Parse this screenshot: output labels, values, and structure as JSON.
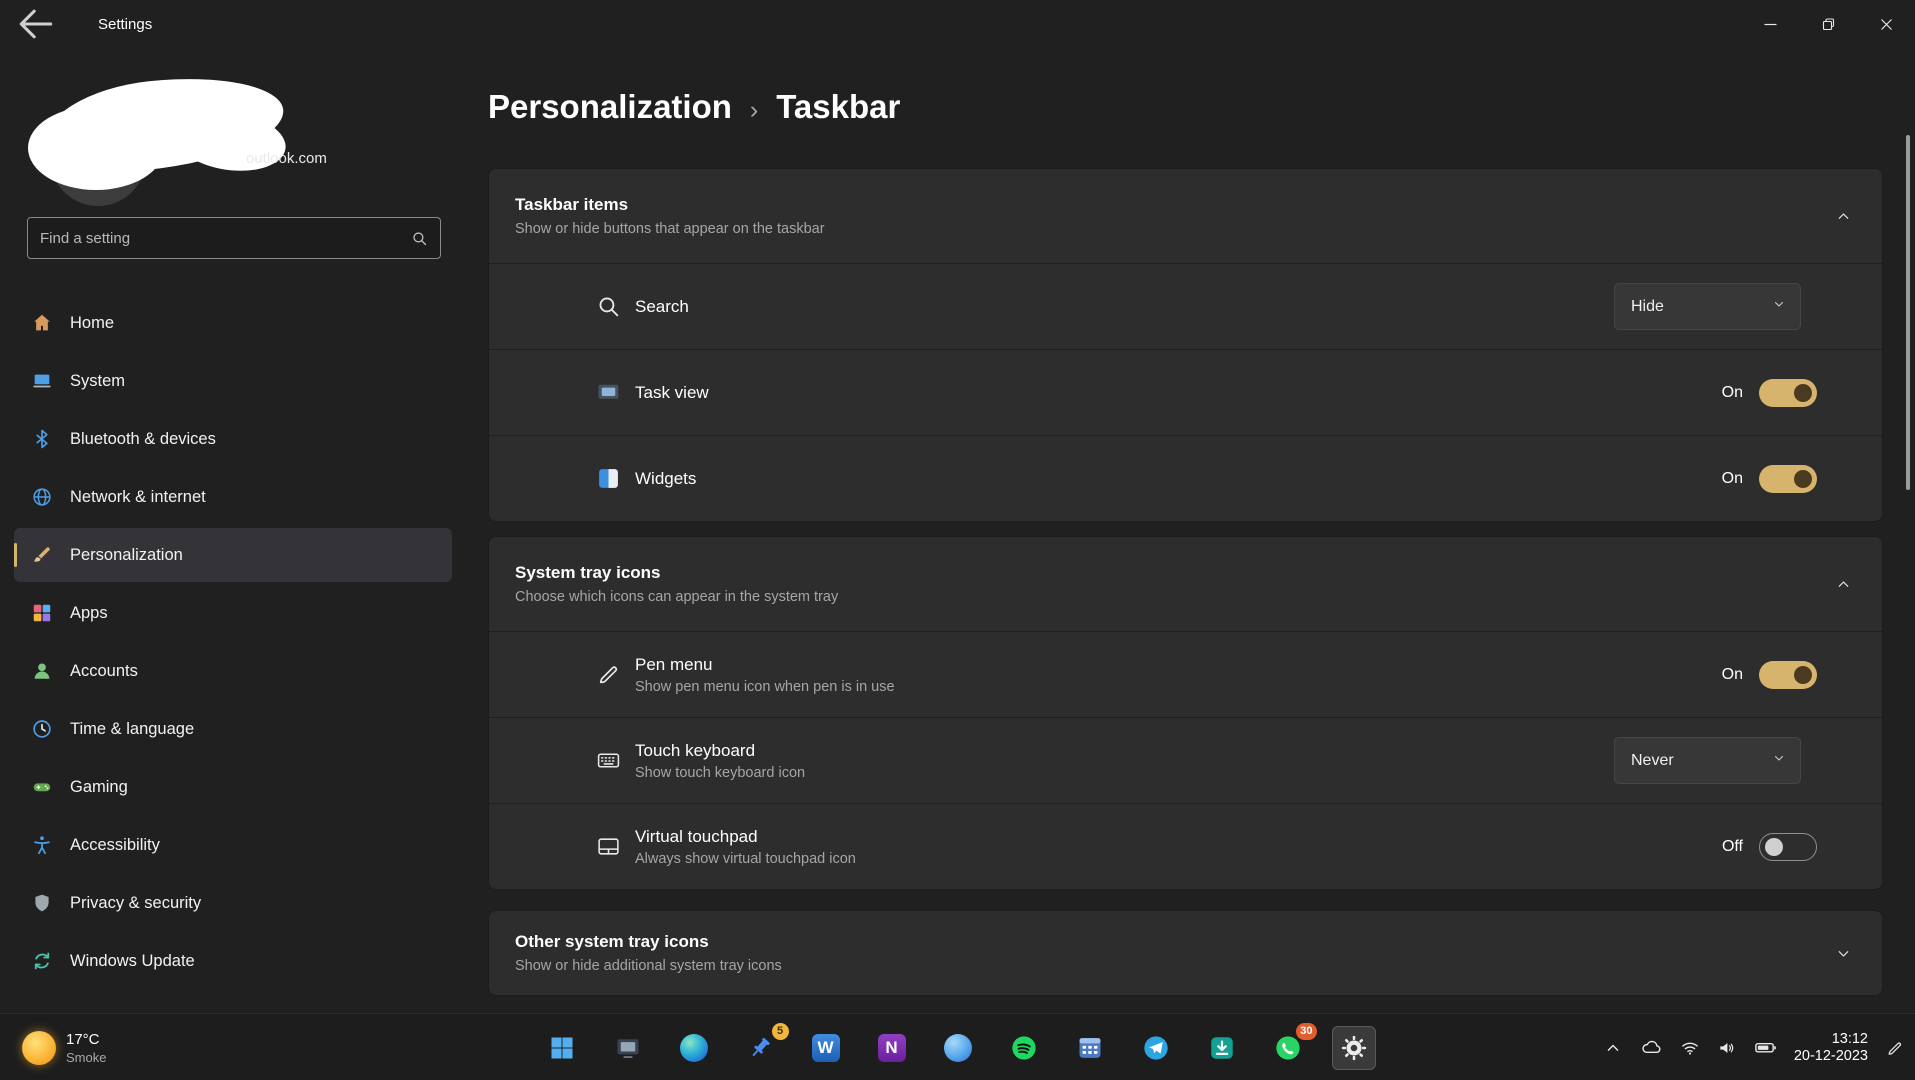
{
  "titlebar": {
    "title": "Settings"
  },
  "sidebar": {
    "user": {
      "email": "outlook.com"
    },
    "search": {
      "placeholder": "Find a setting"
    },
    "items": [
      {
        "label": "Home"
      },
      {
        "label": "System"
      },
      {
        "label": "Bluetooth & devices"
      },
      {
        "label": "Network & internet"
      },
      {
        "label": "Personalization"
      },
      {
        "label": "Apps"
      },
      {
        "label": "Accounts"
      },
      {
        "label": "Time & language"
      },
      {
        "label": "Gaming"
      },
      {
        "label": "Accessibility"
      },
      {
        "label": "Privacy & security"
      },
      {
        "label": "Windows Update"
      }
    ]
  },
  "breadcrumb": {
    "parent": "Personalization",
    "separator": "›",
    "current": "Taskbar"
  },
  "sections": {
    "taskbar_items": {
      "title": "Taskbar items",
      "subtitle": "Show or hide buttons that appear on the taskbar",
      "rows": [
        {
          "label": "Search",
          "control": "dropdown",
          "value": "Hide"
        },
        {
          "label": "Task view",
          "control": "toggle",
          "value": "On"
        },
        {
          "label": "Widgets",
          "control": "toggle",
          "value": "On"
        }
      ]
    },
    "system_tray": {
      "title": "System tray icons",
      "subtitle": "Choose which icons can appear in the system tray",
      "rows": [
        {
          "label": "Pen menu",
          "description": "Show pen menu icon when pen is in use",
          "control": "toggle",
          "value": "On"
        },
        {
          "label": "Touch keyboard",
          "description": "Show touch keyboard icon",
          "control": "dropdown",
          "value": "Never"
        },
        {
          "label": "Virtual touchpad",
          "description": "Always show virtual touchpad icon",
          "control": "toggle",
          "value": "Off"
        }
      ]
    },
    "other_tray": {
      "title": "Other system tray icons",
      "subtitle": "Show or hide additional system tray icons"
    }
  },
  "taskbar": {
    "weather": {
      "temp": "17°C",
      "condition": "Smoke"
    },
    "letters": {
      "word": "W",
      "onenote": "N"
    },
    "badges": {
      "pinned": "5",
      "whatsapp": "30"
    },
    "tray": {
      "time": "13:12",
      "date": "20-12-2023"
    }
  },
  "colors": {
    "accent": "#d6b46e",
    "card": "#2d2d2d",
    "background": "#202020"
  }
}
